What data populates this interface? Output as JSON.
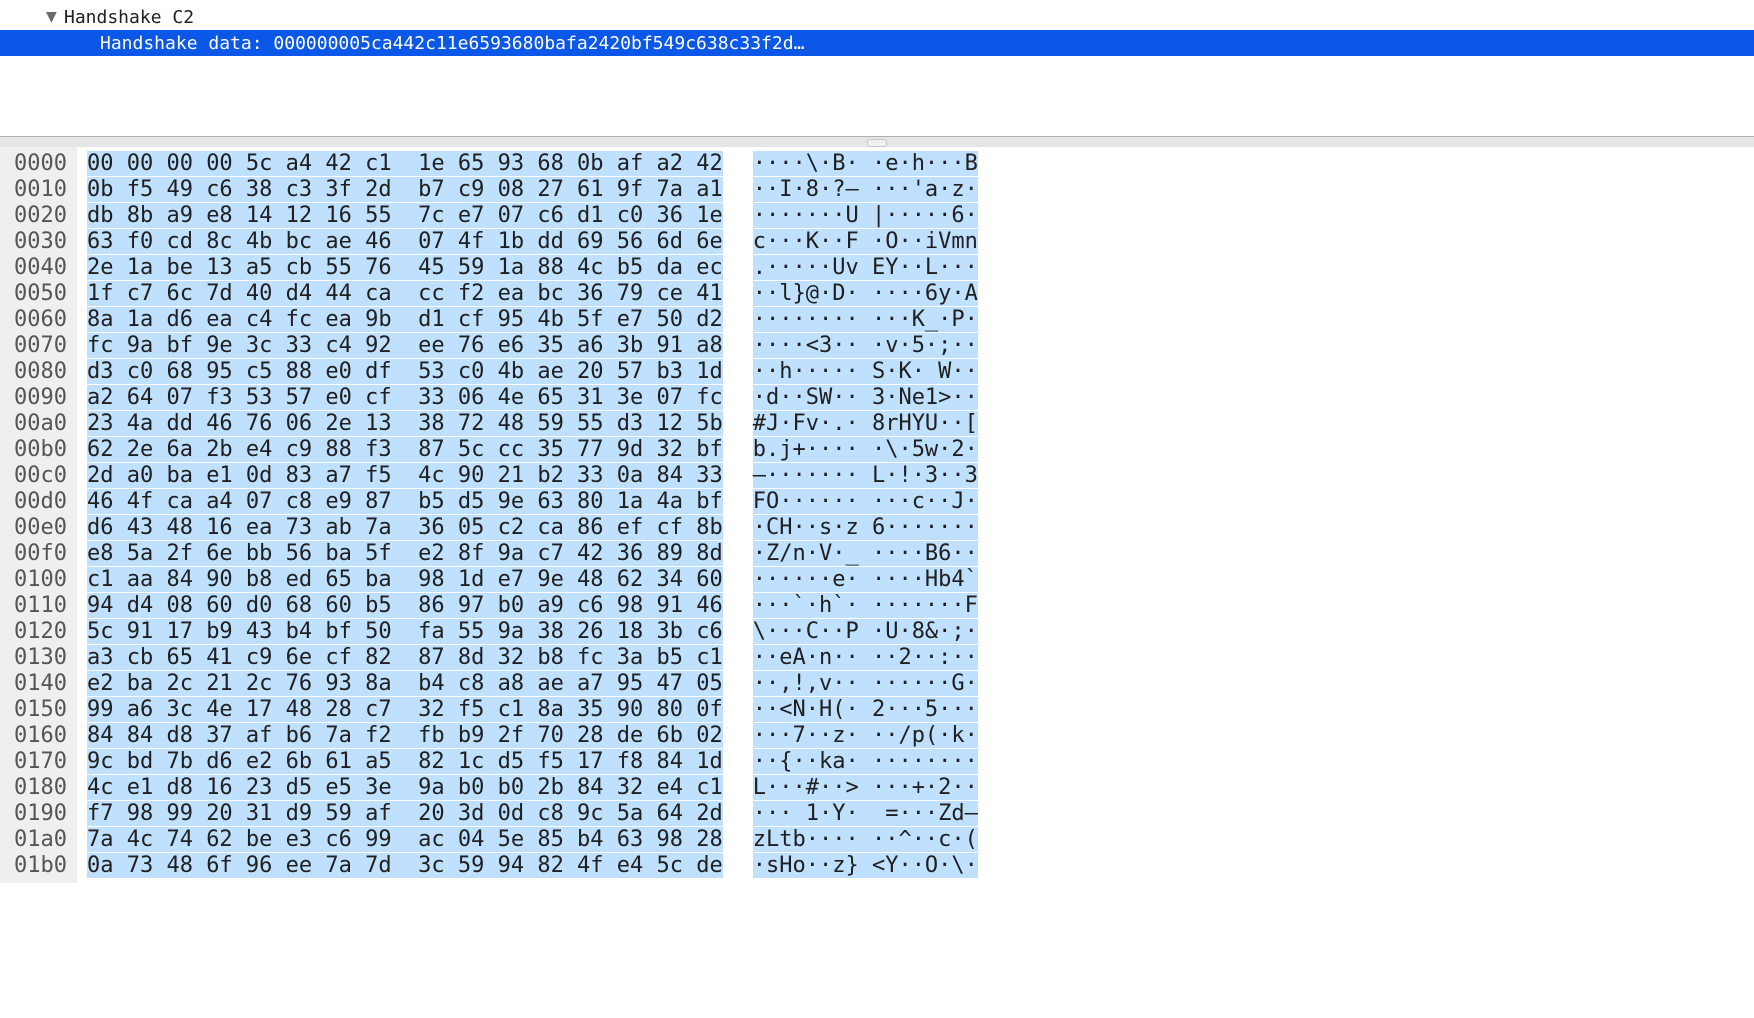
{
  "tree": {
    "section_label": "Handshake C2",
    "selected_field": "Handshake data: 000000005ca442c11e6593680bafa2420bf549c638c33f2d…"
  },
  "hex": {
    "bytes_per_row": 16,
    "rows": [
      {
        "offset": "0000",
        "hex1": "00 00 00 00 5c a4 42 c1",
        "hex2": "1e 65 93 68 0b af a2 42",
        "ascii1": "····\\·B·",
        "ascii2": "·e·h···B"
      },
      {
        "offset": "0010",
        "hex1": "0b f5 49 c6 38 c3 3f 2d",
        "hex2": "b7 c9 08 27 61 9f 7a a1",
        "ascii1": "··I·8·?–",
        "ascii2": "···'a·z·"
      },
      {
        "offset": "0020",
        "hex1": "db 8b a9 e8 14 12 16 55",
        "hex2": "7c e7 07 c6 d1 c0 36 1e",
        "ascii1": "·······U",
        "ascii2": "|·····6·"
      },
      {
        "offset": "0030",
        "hex1": "63 f0 cd 8c 4b bc ae 46",
        "hex2": "07 4f 1b dd 69 56 6d 6e",
        "ascii1": "c···K··F",
        "ascii2": "·O··iVmn"
      },
      {
        "offset": "0040",
        "hex1": "2e 1a be 13 a5 cb 55 76",
        "hex2": "45 59 1a 88 4c b5 da ec",
        "ascii1": ".·····Uv",
        "ascii2": "EY··L···"
      },
      {
        "offset": "0050",
        "hex1": "1f c7 6c 7d 40 d4 44 ca",
        "hex2": "cc f2 ea bc 36 79 ce 41",
        "ascii1": "··l}@·D·",
        "ascii2": "····6y·A"
      },
      {
        "offset": "0060",
        "hex1": "8a 1a d6 ea c4 fc ea 9b",
        "hex2": "d1 cf 95 4b 5f e7 50 d2",
        "ascii1": "········",
        "ascii2": "···K_·P·"
      },
      {
        "offset": "0070",
        "hex1": "fc 9a bf 9e 3c 33 c4 92",
        "hex2": "ee 76 e6 35 a6 3b 91 a8",
        "ascii1": "····<3··",
        "ascii2": "·v·5·;··"
      },
      {
        "offset": "0080",
        "hex1": "d3 c0 68 95 c5 88 e0 df",
        "hex2": "53 c0 4b ae 20 57 b3 1d",
        "ascii1": "··h·····",
        "ascii2": "S·K· W··"
      },
      {
        "offset": "0090",
        "hex1": "a2 64 07 f3 53 57 e0 cf",
        "hex2": "33 06 4e 65 31 3e 07 fc",
        "ascii1": "·d··SW··",
        "ascii2": "3·Ne1>··"
      },
      {
        "offset": "00a0",
        "hex1": "23 4a dd 46 76 06 2e 13",
        "hex2": "38 72 48 59 55 d3 12 5b",
        "ascii1": "#J·Fv·.·",
        "ascii2": "8rHYU··["
      },
      {
        "offset": "00b0",
        "hex1": "62 2e 6a 2b e4 c9 88 f3",
        "hex2": "87 5c cc 35 77 9d 32 bf",
        "ascii1": "b.j+····",
        "ascii2": "·\\·5w·2·"
      },
      {
        "offset": "00c0",
        "hex1": "2d a0 ba e1 0d 83 a7 f5",
        "hex2": "4c 90 21 b2 33 0a 84 33",
        "ascii1": "–·······",
        "ascii2": "L·!·3··3"
      },
      {
        "offset": "00d0",
        "hex1": "46 4f ca a4 07 c8 e9 87",
        "hex2": "b5 d5 9e 63 80 1a 4a bf",
        "ascii1": "FO······",
        "ascii2": "···c··J·"
      },
      {
        "offset": "00e0",
        "hex1": "d6 43 48 16 ea 73 ab 7a",
        "hex2": "36 05 c2 ca 86 ef cf 8b",
        "ascii1": "·CH··s·z",
        "ascii2": "6·······"
      },
      {
        "offset": "00f0",
        "hex1": "e8 5a 2f 6e bb 56 ba 5f",
        "hex2": "e2 8f 9a c7 42 36 89 8d",
        "ascii1": "·Z/n·V·_",
        "ascii2": "····B6··"
      },
      {
        "offset": "0100",
        "hex1": "c1 aa 84 90 b8 ed 65 ba",
        "hex2": "98 1d e7 9e 48 62 34 60",
        "ascii1": "······e·",
        "ascii2": "····Hb4`"
      },
      {
        "offset": "0110",
        "hex1": "94 d4 08 60 d0 68 60 b5",
        "hex2": "86 97 b0 a9 c6 98 91 46",
        "ascii1": "···`·h`·",
        "ascii2": "·······F"
      },
      {
        "offset": "0120",
        "hex1": "5c 91 17 b9 43 b4 bf 50",
        "hex2": "fa 55 9a 38 26 18 3b c6",
        "ascii1": "\\···C··P",
        "ascii2": "·U·8&·;·"
      },
      {
        "offset": "0130",
        "hex1": "a3 cb 65 41 c9 6e cf 82",
        "hex2": "87 8d 32 b8 fc 3a b5 c1",
        "ascii1": "··eA·n··",
        "ascii2": "··2··:··"
      },
      {
        "offset": "0140",
        "hex1": "e2 ba 2c 21 2c 76 93 8a",
        "hex2": "b4 c8 a8 ae a7 95 47 05",
        "ascii1": "··,!,v··",
        "ascii2": "······G·"
      },
      {
        "offset": "0150",
        "hex1": "99 a6 3c 4e 17 48 28 c7",
        "hex2": "32 f5 c1 8a 35 90 80 0f",
        "ascii1": "··<N·H(·",
        "ascii2": "2···5···"
      },
      {
        "offset": "0160",
        "hex1": "84 84 d8 37 af b6 7a f2",
        "hex2": "fb b9 2f 70 28 de 6b 02",
        "ascii1": "···7··z·",
        "ascii2": "··/p(·k·"
      },
      {
        "offset": "0170",
        "hex1": "9c bd 7b d6 e2 6b 61 a5",
        "hex2": "82 1c d5 f5 17 f8 84 1d",
        "ascii1": "··{··ka·",
        "ascii2": "········"
      },
      {
        "offset": "0180",
        "hex1": "4c e1 d8 16 23 d5 e5 3e",
        "hex2": "9a b0 b0 2b 84 32 e4 c1",
        "ascii1": "L···#··>",
        "ascii2": "···+·2··"
      },
      {
        "offset": "0190",
        "hex1": "f7 98 99 20 31 d9 59 af",
        "hex2": "20 3d 0d c8 9c 5a 64 2d",
        "ascii1": "··· 1·Y·",
        "ascii2": " =···Zd–"
      },
      {
        "offset": "01a0",
        "hex1": "7a 4c 74 62 be e3 c6 99",
        "hex2": "ac 04 5e 85 b4 63 98 28",
        "ascii1": "zLtb····",
        "ascii2": "··^··c·("
      },
      {
        "offset": "01b0",
        "hex1": "0a 73 48 6f 96 ee 7a 7d",
        "hex2": "3c 59 94 82 4f e4 5c de",
        "ascii1": "·sHo··z}",
        "ascii2": "<Y··O·\\·"
      }
    ]
  }
}
